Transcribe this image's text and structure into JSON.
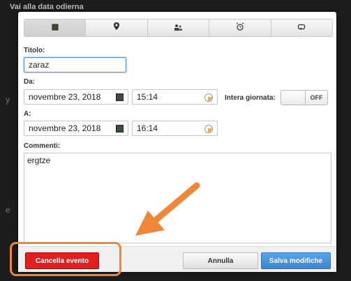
{
  "backdrop": {
    "title": "Vai alla data odierna",
    "fragment_left": "y",
    "fragment_bottom": "e"
  },
  "tabs": [
    {
      "icon": "calendar-icon",
      "active": true
    },
    {
      "icon": "location-pin-icon",
      "active": false
    },
    {
      "icon": "people-icon",
      "active": false
    },
    {
      "icon": "alarm-clock-icon",
      "active": false
    },
    {
      "icon": "repeat-icon",
      "active": false
    }
  ],
  "form": {
    "title_label": "Titolo:",
    "title_value": "zaraz",
    "from_label": "Da:",
    "from_date": "novembre 23, 2018",
    "from_time": "15:14",
    "allday_label": "Intera giornata:",
    "allday_state": "OFF",
    "to_label": "A:",
    "to_date": "novembre 23, 2018",
    "to_time": "16:14",
    "comments_label": "Commenti:",
    "comments_value": "ergtze"
  },
  "buttons": {
    "delete": "Cancella evento",
    "cancel": "Annulla",
    "save": "Salva modifiche"
  },
  "colors": {
    "danger": "#e02020",
    "primary": "#3a85d0",
    "annotation": "#ee8838"
  }
}
